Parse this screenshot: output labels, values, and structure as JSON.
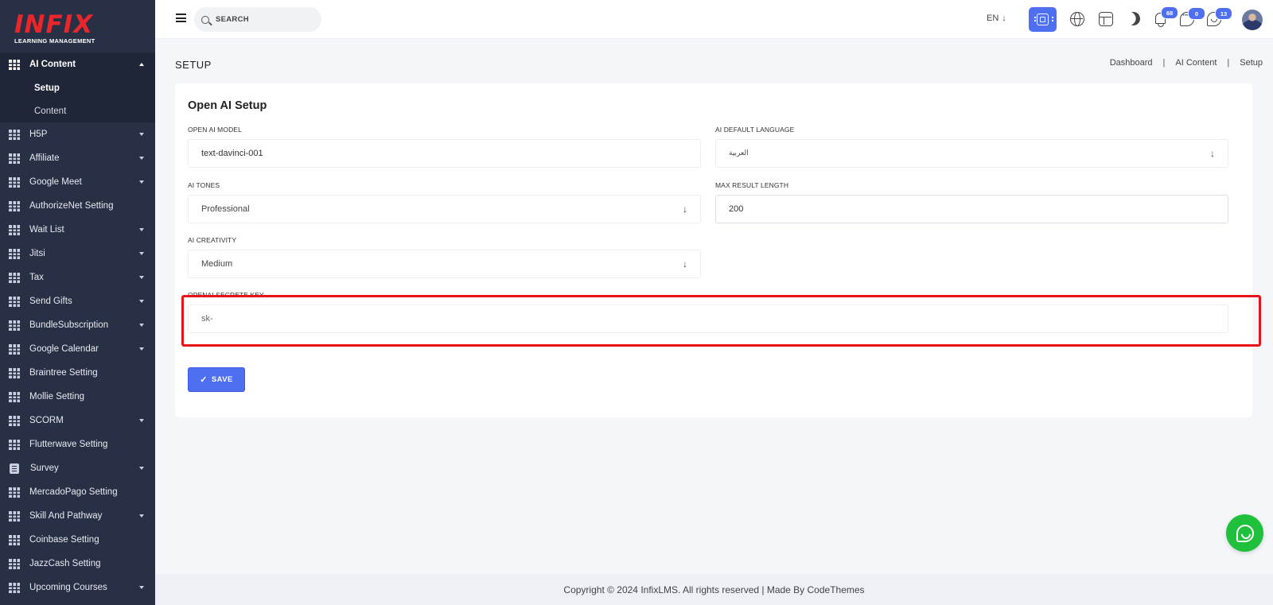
{
  "logo": {
    "main": "INFIX",
    "sub": "LEARNING MANAGEMENT"
  },
  "sidebar": {
    "active_group": {
      "label": "AI Content",
      "icon": "grid-icon"
    },
    "sub_items": [
      {
        "label": "Setup"
      },
      {
        "label": "Content"
      }
    ],
    "items": [
      {
        "label": "H5P",
        "icon": "grid-icon",
        "has_caret": true
      },
      {
        "label": "Affiliate",
        "icon": "grid-icon",
        "has_caret": true
      },
      {
        "label": "Google Meet",
        "icon": "grid-icon",
        "has_caret": true
      },
      {
        "label": "AuthorizeNet Setting",
        "icon": "grid-icon",
        "has_caret": false
      },
      {
        "label": "Wait List",
        "icon": "grid-icon",
        "has_caret": true
      },
      {
        "label": "Jitsi",
        "icon": "grid-icon",
        "has_caret": true
      },
      {
        "label": "Tax",
        "icon": "grid-icon",
        "has_caret": true
      },
      {
        "label": "Send Gifts",
        "icon": "grid-icon",
        "has_caret": true
      },
      {
        "label": "BundleSubscription",
        "icon": "grid-icon",
        "has_caret": true
      },
      {
        "label": "Google Calendar",
        "icon": "grid-icon",
        "has_caret": true
      },
      {
        "label": "Braintree Setting",
        "icon": "grid-icon",
        "has_caret": false
      },
      {
        "label": "Mollie Setting",
        "icon": "grid-icon",
        "has_caret": false
      },
      {
        "label": "SCORM",
        "icon": "grid-icon",
        "has_caret": true
      },
      {
        "label": "Flutterwave Setting",
        "icon": "grid-icon",
        "has_caret": false
      },
      {
        "label": "Survey",
        "icon": "doc-icon",
        "has_caret": true
      },
      {
        "label": "MercadoPago Setting",
        "icon": "grid-icon",
        "has_caret": false
      },
      {
        "label": "Skill And Pathway",
        "icon": "grid-icon",
        "has_caret": true
      },
      {
        "label": "Coinbase Setting",
        "icon": "grid-icon",
        "has_caret": false
      },
      {
        "label": "JazzCash Setting",
        "icon": "grid-icon",
        "has_caret": false
      },
      {
        "label": "Upcoming Courses",
        "icon": "grid-icon",
        "has_caret": true
      }
    ]
  },
  "topbar": {
    "search_placeholder": "SEARCH",
    "language": "EN",
    "badges": {
      "notifications": "68",
      "messages": "0",
      "whatsapp": "13"
    }
  },
  "page": {
    "title": "SETUP",
    "breadcrumb": [
      "Dashboard",
      "AI Content",
      "Setup"
    ]
  },
  "form": {
    "card_title": "Open AI Setup",
    "open_ai_model": {
      "label": "OPEN AI MODEL",
      "value": "text-davinci-001"
    },
    "ai_default_language": {
      "label": "AI DEFAULT LANGUAGE",
      "value": "العربية"
    },
    "ai_tones": {
      "label": "AI TONES",
      "value": "Professional"
    },
    "max_result_length": {
      "label": "MAX RESULT LENGTH",
      "value": "200"
    },
    "ai_creativity": {
      "label": "AI CREATIVITY",
      "value": "Medium"
    },
    "openai_secret_key": {
      "label": "OPENAI SECRETE KEY",
      "placeholder": "sk-"
    },
    "save_label": "SAVE"
  },
  "footer": {
    "text": "Copyright © 2024 InfixLMS. All rights reserved | Made By CodeThemes"
  },
  "colors": {
    "accent": "#4e6ff0",
    "sidebar_bg": "#273044",
    "highlight": "#e8141b",
    "whatsapp": "#1fc03c"
  }
}
